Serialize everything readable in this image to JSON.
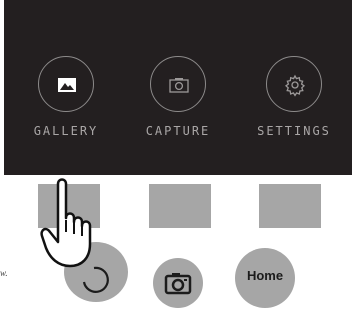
{
  "menu": {
    "items": [
      {
        "label": "GALLERY",
        "icon": "image-icon"
      },
      {
        "label": "CAPTURE",
        "icon": "camera-icon"
      },
      {
        "label": "SETTINGS",
        "icon": "gear-icon"
      }
    ]
  },
  "controls": {
    "home_label": "Home",
    "back_icon": "back-arrow-icon",
    "camera_icon": "camera-icon"
  },
  "side_note": "w.",
  "colors": {
    "panel_bg": "#231f20",
    "label": "#a9a6a6",
    "button_gray": "#a6a6a6"
  }
}
